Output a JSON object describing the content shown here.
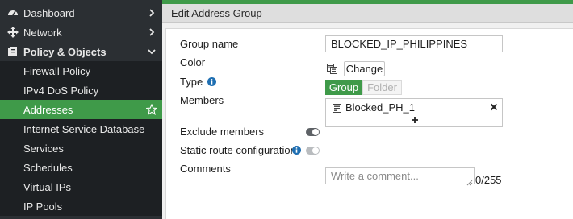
{
  "sidebar": {
    "items": [
      {
        "label": "Dashboard",
        "icon": "dashboard-icon"
      },
      {
        "label": "Network",
        "icon": "network-icon"
      },
      {
        "label": "Policy & Objects",
        "icon": "policy-objects-icon"
      },
      {
        "label": "Firewall Policy"
      },
      {
        "label": "IPv4 DoS Policy"
      },
      {
        "label": "Addresses"
      },
      {
        "label": "Internet Service Database"
      },
      {
        "label": "Services"
      },
      {
        "label": "Schedules"
      },
      {
        "label": "Virtual IPs"
      },
      {
        "label": "IP Pools"
      }
    ]
  },
  "header": {
    "title": "Edit Address Group"
  },
  "form": {
    "group_name_label": "Group name",
    "group_name_value": "BLOCKED_IP_PHILIPPINES",
    "color_label": "Color",
    "color_button": "Change",
    "type_label": "Type",
    "type_options": [
      "Group",
      "Folder"
    ],
    "members_label": "Members",
    "members": [
      "Blocked_PH_1"
    ],
    "exclude_label": "Exclude members",
    "static_route_label": "Static route configuration",
    "comments_label": "Comments",
    "comments_placeholder": "Write a comment...",
    "comments_count": "0/255"
  },
  "colors": {
    "accent": "#3f9a49",
    "sidebar_bg": "#2b2f33",
    "sidebar_sub_bg": "#1d2023",
    "info": "#1f6fb2"
  }
}
